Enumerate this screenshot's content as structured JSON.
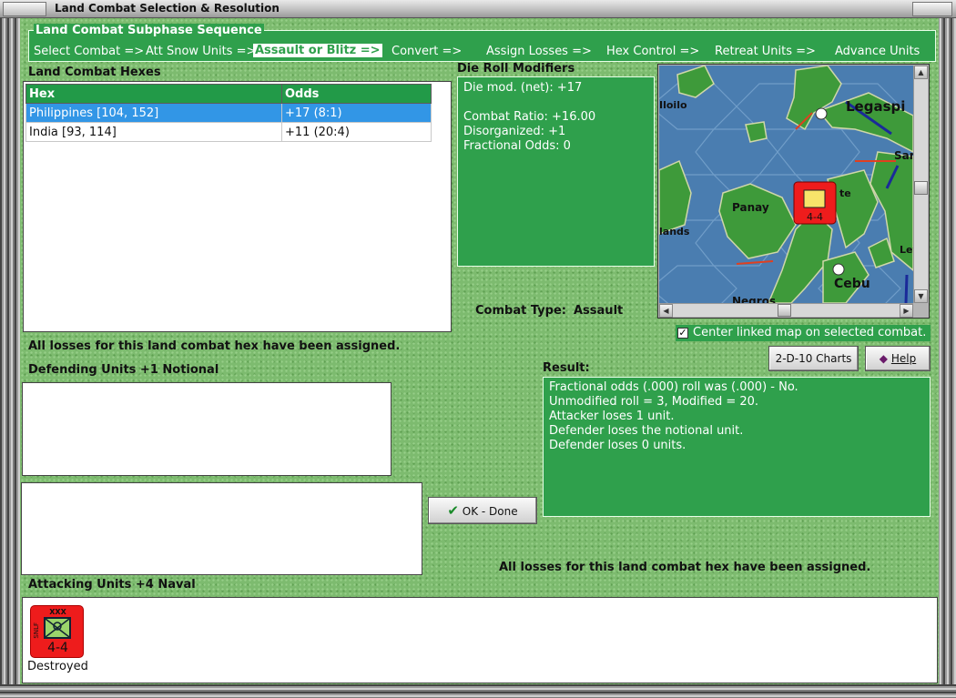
{
  "window": {
    "title": "Land Combat Selection & Resolution"
  },
  "sequence": {
    "legend": "Land Combat Subphase Sequence",
    "steps": [
      "Select Combat =>",
      "Att Snow Units =>",
      "Assault or Blitz =>",
      "Convert =>",
      "Assign Losses =>",
      "Hex Control =>",
      "Retreat Units =>",
      "Advance Units"
    ],
    "active_index": 2
  },
  "hexes": {
    "heading": "Land Combat Hexes",
    "columns": [
      "Hex",
      "Odds"
    ],
    "rows": [
      {
        "hex": "Philippines [104, 152]",
        "odds": "+17 (8:1)",
        "selected": true
      },
      {
        "hex": "India [93, 114]",
        "odds": "+11 (20:4)",
        "selected": false
      }
    ]
  },
  "die_roll": {
    "heading": "Die Roll Modifiers",
    "lines": [
      "Die mod. (net): +17",
      "",
      "Combat Ratio: +16.00",
      "Disorganized: +1",
      "Fractional Odds: 0"
    ]
  },
  "combat_type": {
    "label": "Combat Type:",
    "value": "Assault"
  },
  "map": {
    "labels": [
      "Legaspi",
      "Iloilo",
      "Panay",
      "Sam",
      "Cebu",
      "Negros",
      "lands",
      "Ley",
      "te"
    ],
    "unit_strength": "4-4"
  },
  "center_map": {
    "label": "Center linked map on selected combat.",
    "checked": true
  },
  "losses_msg_top": "All losses for this land combat hex have been assigned.",
  "defending": {
    "heading": "Defending Units +1 Notional"
  },
  "buttons": {
    "charts": "2-D-10 Charts",
    "help": "Help",
    "ok": "OK - Done"
  },
  "result": {
    "heading": "Result:",
    "lines": [
      "Fractional odds (.000) roll was (.000)  - No.",
      "Unmodified roll = 3, Modified = 20.",
      "Attacker loses 1 unit.",
      "Defender loses the notional unit.",
      "Defender loses 0 units."
    ]
  },
  "losses_msg_bottom": "All losses for this land combat hex have been assigned.",
  "attacking": {
    "heading": "Attacking Units +4 Naval",
    "units": [
      {
        "size": "XXX",
        "type": "SNLF",
        "strength": "4-4",
        "status": "Destroyed"
      }
    ]
  },
  "colors": {
    "panel_green": "#2fa04c",
    "felt_green": "#7dbb6f",
    "selection_blue": "#3296e6",
    "counter_red": "#ee1c1c"
  }
}
